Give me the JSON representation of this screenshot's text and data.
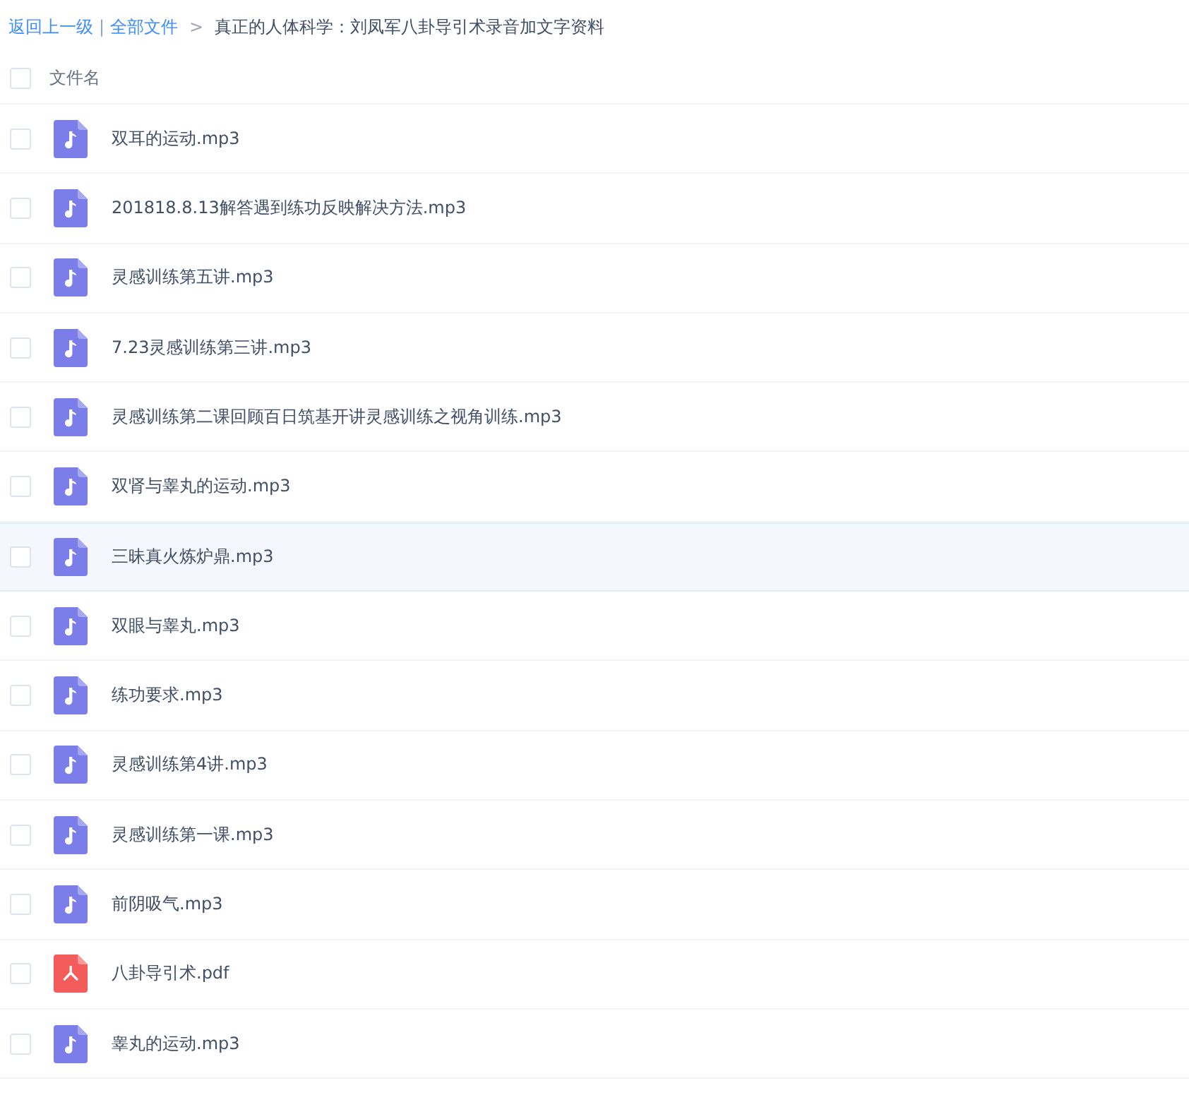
{
  "breadcrumb": {
    "back": "返回上一级",
    "separator": "|",
    "root": "全部文件",
    "arrow": ">",
    "current": "真正的人体科学：刘凤军八卦导引术录音加文字资料"
  },
  "header": {
    "checked": false,
    "label": "文件名"
  },
  "files": [
    {
      "name": "双耳的运动.mp3",
      "kind": "audio",
      "checked": false,
      "highlighted": false
    },
    {
      "name": "201818.8.13解答遇到练功反映解决方法.mp3",
      "kind": "audio",
      "checked": false,
      "highlighted": false
    },
    {
      "name": "灵感训练第五讲.mp3",
      "kind": "audio",
      "checked": false,
      "highlighted": false
    },
    {
      "name": "7.23灵感训练第三讲.mp3",
      "kind": "audio",
      "checked": false,
      "highlighted": false
    },
    {
      "name": "灵感训练第二课回顾百日筑基开讲灵感训练之视角训练.mp3",
      "kind": "audio",
      "checked": false,
      "highlighted": false
    },
    {
      "name": "双肾与睾丸的运动.mp3",
      "kind": "audio",
      "checked": false,
      "highlighted": false
    },
    {
      "name": "三昧真火炼炉鼎.mp3",
      "kind": "audio",
      "checked": false,
      "highlighted": true
    },
    {
      "name": "双眼与睾丸.mp3",
      "kind": "audio",
      "checked": false,
      "highlighted": false
    },
    {
      "name": "练功要求.mp3",
      "kind": "audio",
      "checked": false,
      "highlighted": false
    },
    {
      "name": "灵感训练第4讲.mp3",
      "kind": "audio",
      "checked": false,
      "highlighted": false
    },
    {
      "name": "灵感训练第一课.mp3",
      "kind": "audio",
      "checked": false,
      "highlighted": false
    },
    {
      "name": "前阴吸气.mp3",
      "kind": "audio",
      "checked": false,
      "highlighted": false
    },
    {
      "name": "八卦导引术.pdf",
      "kind": "pdf",
      "checked": false,
      "highlighted": false
    },
    {
      "name": "睾丸的运动.mp3",
      "kind": "audio",
      "checked": false,
      "highlighted": false
    }
  ]
}
